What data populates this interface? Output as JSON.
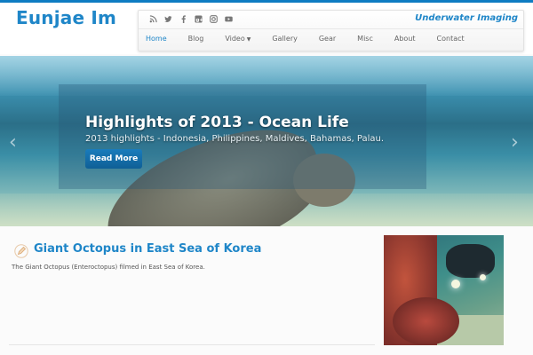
{
  "site": {
    "title": "Eunjae Im",
    "tagline": "Underwater Imaging"
  },
  "social_icons": [
    "rss-icon",
    "twitter-icon",
    "facebook-icon",
    "google-plus-icon",
    "instagram-icon",
    "youtube-icon"
  ],
  "menu": {
    "items": [
      {
        "label": "Home",
        "active": true
      },
      {
        "label": "Blog"
      },
      {
        "label": "Video",
        "dropdown": true
      },
      {
        "label": "Gallery"
      },
      {
        "label": "Gear"
      },
      {
        "label": "Misc"
      },
      {
        "label": "About"
      },
      {
        "label": "Contact"
      }
    ]
  },
  "slider": {
    "title": "Highlights of 2013 - Ocean Life",
    "subtitle": "2013 highlights - Indonesia, Philippines, Maldives, Bahamas, Palau.",
    "button_label": "Read More",
    "prev_arrow": "‹",
    "next_arrow": "›"
  },
  "post": {
    "title": "Giant Octopus in East Sea of Korea",
    "excerpt": "The Giant Octopus (Enteroctopus) filmed in East Sea of Korea."
  },
  "colors": {
    "accent": "#1f86c8",
    "top_bar": "#0e7cc2",
    "button": "#1a7cbc"
  }
}
